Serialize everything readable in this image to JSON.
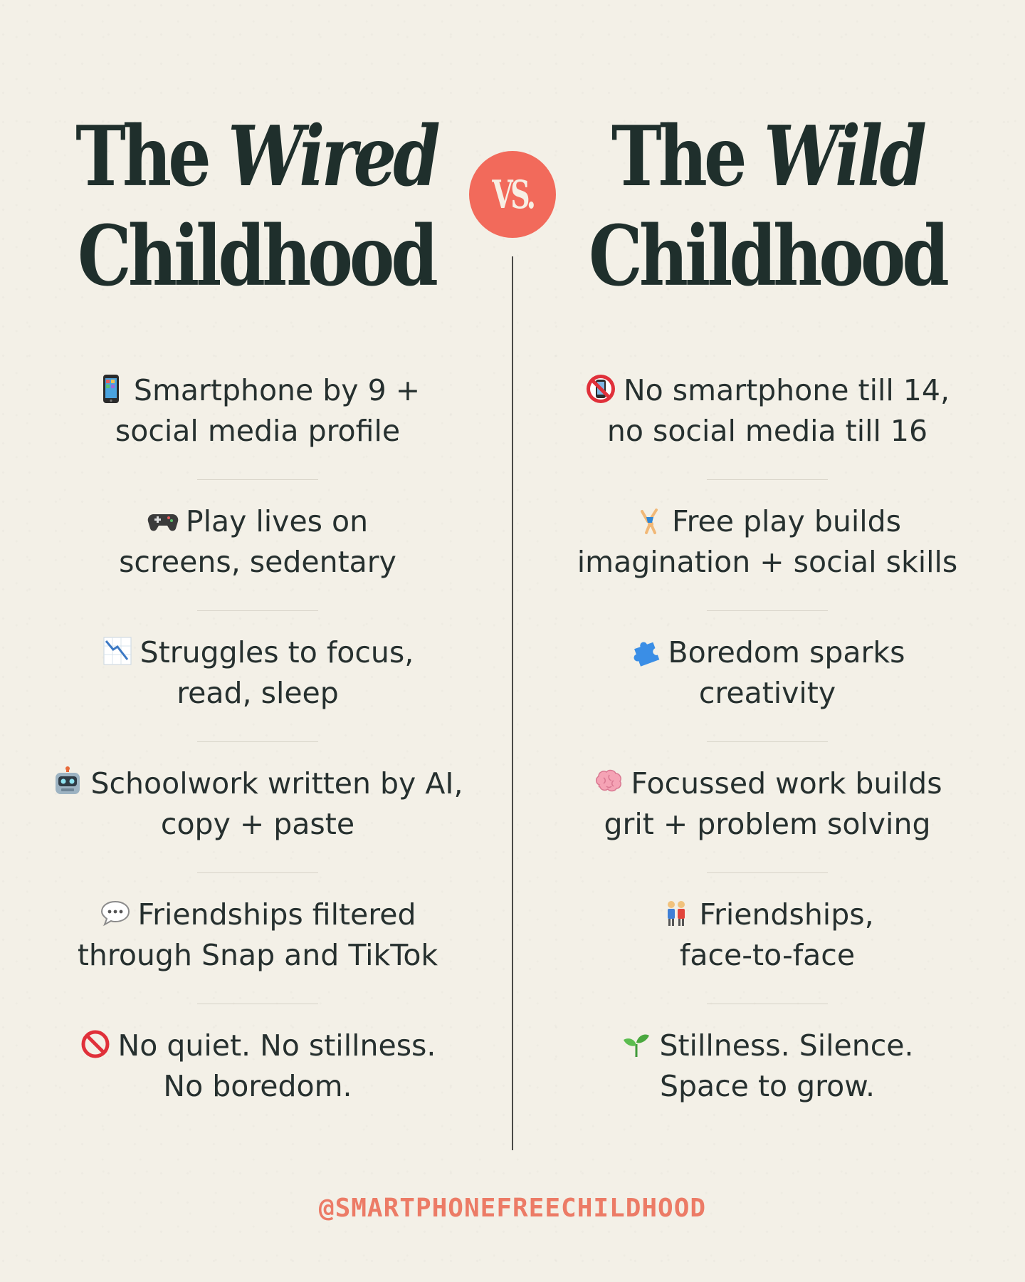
{
  "left": {
    "title_line1_plain": "The",
    "title_line1_italic": "Wired",
    "title_line2": "Childhood",
    "items": [
      {
        "icon": "mobile-phone-icon",
        "text": "Smartphone by 9 +\nsocial media profile"
      },
      {
        "icon": "game-controller-icon",
        "text": "Play lives on\nscreens, sedentary"
      },
      {
        "icon": "chart-decreasing-icon",
        "text": "Struggles to focus,\nread, sleep"
      },
      {
        "icon": "robot-icon",
        "text": "Schoolwork written by AI,\ncopy + paste"
      },
      {
        "icon": "speech-bubble-icon",
        "text": "Friendships filtered\nthrough Snap and TikTok"
      },
      {
        "icon": "prohibited-icon",
        "text": "No quiet. No stillness.\nNo boredom."
      }
    ]
  },
  "vs": "VS.",
  "right": {
    "title_line1_plain": "The",
    "title_line1_italic": "Wild",
    "title_line2": "Childhood",
    "items": [
      {
        "icon": "no-mobile-phones-icon",
        "text": "No smartphone till 14,\nno social media till 16"
      },
      {
        "icon": "cartwheel-icon",
        "text": "Free play builds\nimagination + social skills"
      },
      {
        "icon": "puzzle-piece-icon",
        "text": "Boredom sparks\ncreativity"
      },
      {
        "icon": "brain-icon",
        "text": "Focussed work builds\ngrit + problem solving"
      },
      {
        "icon": "two-people-icon",
        "text": "Friendships,\nface-to-face"
      },
      {
        "icon": "seedling-icon",
        "text": "Stillness. Silence.\nSpace to grow."
      }
    ]
  },
  "footer_handle": "@SMARTPHONEFREECHILDHOOD",
  "colors": {
    "background": "#f3f0e7",
    "title": "#1f2f2c",
    "accent": "#f26a5b",
    "handle": "#ec7b66",
    "body_text": "#26302f"
  }
}
